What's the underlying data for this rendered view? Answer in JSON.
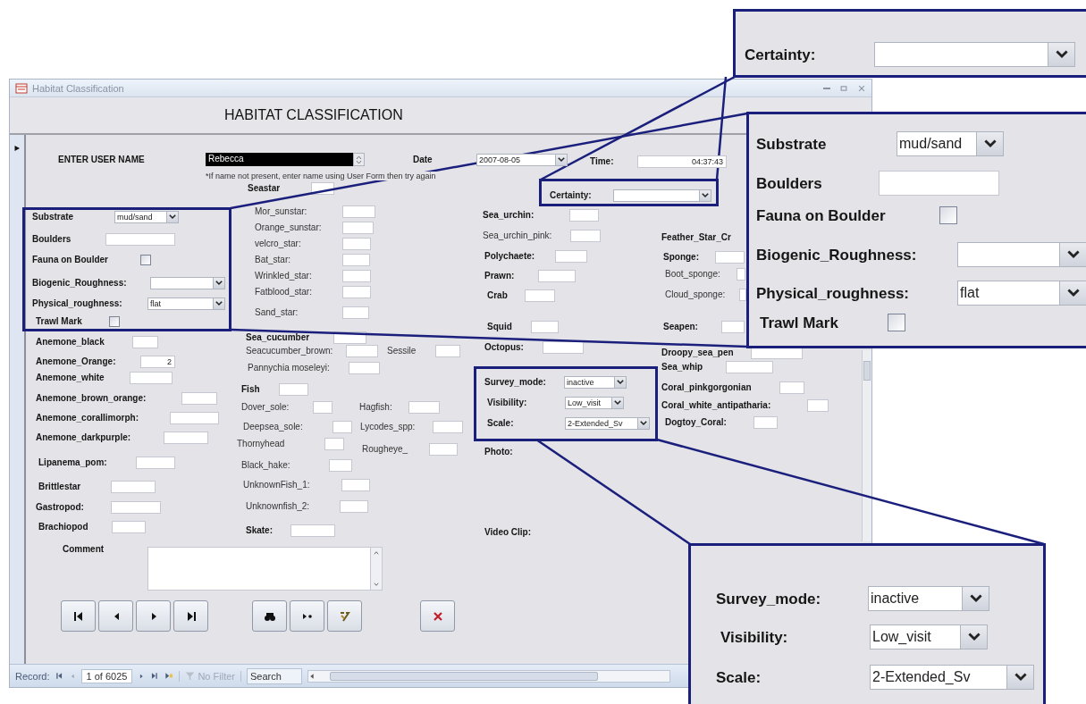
{
  "window": {
    "title": "Habitat Classification"
  },
  "heading": "HABITAT CLASSIFICATION",
  "header_fields": [
    {
      "label": "ENTER USER NAME",
      "kind": "spinner",
      "value": "Rebecca"
    },
    {
      "label": "Date",
      "kind": "combo",
      "value": "2007-08-05"
    },
    {
      "label": "Time:",
      "kind": "text",
      "value": "04:37:43"
    }
  ],
  "note": "*If name not present, enter name using User Form then try again",
  "fields": [
    {
      "label": "Seastar",
      "kind": "text"
    },
    {
      "label": "Certainty:",
      "kind": "combo"
    },
    {
      "label": "Substrate",
      "kind": "combo",
      "value": "mud/sand"
    },
    {
      "label": "Mor_sunstar:",
      "kind": "text"
    },
    {
      "label": "Sea_urchin:",
      "kind": "text"
    },
    {
      "label": "Orange_sunstar:",
      "kind": "text"
    },
    {
      "label": "Boulders",
      "kind": "text"
    },
    {
      "label": "velcro_star:",
      "kind": "text"
    },
    {
      "label": "Sea_urchin_pink:",
      "kind": "text"
    },
    {
      "label": "Feather_Star_Cr",
      "kind": "label"
    },
    {
      "label": "Fauna on Boulder",
      "kind": "check",
      "checked": false
    },
    {
      "label": "Bat_star:",
      "kind": "text"
    },
    {
      "label": "Polychaete:",
      "kind": "text"
    },
    {
      "label": "Sponge:",
      "kind": "text"
    },
    {
      "label": "Wrinkled_star:",
      "kind": "text"
    },
    {
      "label": "Prawn:",
      "kind": "text"
    },
    {
      "label": "Boot_sponge:",
      "kind": "text"
    },
    {
      "label": "Biogenic_Roughness:",
      "kind": "combo"
    },
    {
      "label": "Fatblood_star:",
      "kind": "text"
    },
    {
      "label": "Crab",
      "kind": "text"
    },
    {
      "label": "Cloud_sponge:",
      "kind": "text"
    },
    {
      "label": "Physical_roughness:",
      "kind": "combo",
      "value": "flat"
    },
    {
      "label": "Sand_star:",
      "kind": "text"
    },
    {
      "label": "Trawl Mark",
      "kind": "check",
      "checked": false
    },
    {
      "label": "Squid",
      "kind": "text"
    },
    {
      "label": "Seapen:",
      "kind": "text"
    },
    {
      "label": "Anemone_black",
      "kind": "text"
    },
    {
      "label": "Sea_cucumber",
      "kind": "text"
    },
    {
      "label": "Seacucumber_brown:",
      "kind": "text"
    },
    {
      "label": "Sessile",
      "kind": "text"
    },
    {
      "label": "Octopus:",
      "kind": "text"
    },
    {
      "label": "Anemone_Orange:",
      "kind": "text",
      "value": "2"
    },
    {
      "label": "Droopy_sea_pen",
      "kind": "text"
    },
    {
      "label": "Pannychia moseleyi:",
      "kind": "text"
    },
    {
      "label": "Sea_whip",
      "kind": "text"
    },
    {
      "label": "Anemone_white",
      "kind": "text"
    },
    {
      "label": "Fish",
      "kind": "text"
    },
    {
      "label": "Survey_mode:",
      "kind": "combo",
      "value": "inactive"
    },
    {
      "label": "Coral_pinkgorgonian",
      "kind": "text"
    },
    {
      "label": "Anemone_brown_orange:",
      "kind": "text"
    },
    {
      "label": "Dover_sole:",
      "kind": "text"
    },
    {
      "label": "Hagfish:",
      "kind": "text"
    },
    {
      "label": "Visibility:",
      "kind": "combo",
      "value": "Low_visit"
    },
    {
      "label": "Coral_white_antipatharia:",
      "kind": "text"
    },
    {
      "label": "Anemone_corallimorph:",
      "kind": "text"
    },
    {
      "label": "Deepsea_sole:",
      "kind": "text"
    },
    {
      "label": "Lycodes_spp:",
      "kind": "text"
    },
    {
      "label": "Scale:",
      "kind": "combo",
      "value": "2-Extended_Sv"
    },
    {
      "label": "Dogtoy_Coral:",
      "kind": "text"
    },
    {
      "label": "Anemone_darkpurple:",
      "kind": "text"
    },
    {
      "label": "Thornyhead",
      "kind": "text"
    },
    {
      "label": "Rougheye_",
      "kind": "text"
    },
    {
      "label": "Photo:",
      "kind": "label"
    },
    {
      "label": "Lipanema_pom:",
      "kind": "text"
    },
    {
      "label": "Black_hake:",
      "kind": "text"
    },
    {
      "label": "Brittlestar",
      "kind": "text"
    },
    {
      "label": "UnknownFish_1:",
      "kind": "text"
    },
    {
      "label": "Gastropod:",
      "kind": "text"
    },
    {
      "label": "Unknownfish_2:",
      "kind": "text"
    },
    {
      "label": "Brachiopod",
      "kind": "text"
    },
    {
      "label": "Skate:",
      "kind": "text"
    },
    {
      "label": "Video Clip:",
      "kind": "label"
    }
  ],
  "comment": {
    "label": "Comment"
  },
  "record_bar": {
    "label": "Record:",
    "position": "1 of 6025",
    "filter": "No Filter",
    "search": {
      "placeholder": "Search"
    }
  },
  "callouts": [
    {
      "fields": [
        {
          "label": "Certainty:",
          "kind": "combo"
        }
      ]
    },
    {
      "fields": [
        {
          "label": "Substrate",
          "kind": "combo",
          "value": "mud/sand"
        },
        {
          "label": "Boulders",
          "kind": "text"
        },
        {
          "label": "Fauna on Boulder",
          "kind": "check",
          "checked": false
        },
        {
          "label": "Biogenic_Roughness:",
          "kind": "combo"
        },
        {
          "label": "Physical_roughness:",
          "kind": "combo",
          "value": "flat"
        },
        {
          "label": "Trawl Mark",
          "kind": "check",
          "checked": false
        }
      ]
    },
    {
      "fields": [
        {
          "label": "Survey_mode:",
          "kind": "combo",
          "value": "inactive"
        },
        {
          "label": "Visibility:",
          "kind": "combo",
          "value": "Low_visit"
        },
        {
          "label": "Scale:",
          "kind": "combo",
          "value": "2-Extended_Sv"
        }
      ]
    }
  ]
}
